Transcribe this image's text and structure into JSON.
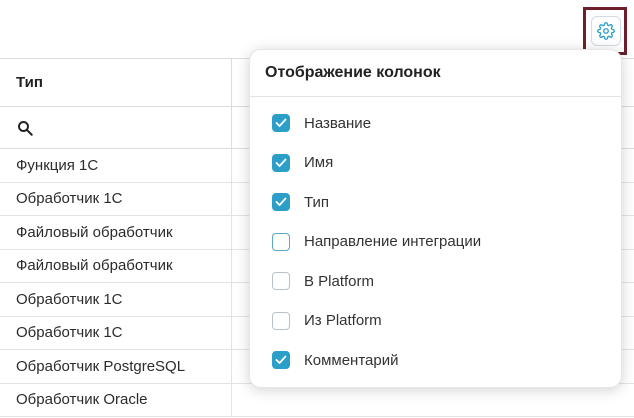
{
  "toolbar": {
    "settings_icon": "gear-icon",
    "accent": "#2b9fc8",
    "focus_border": "#6e1f2b"
  },
  "table": {
    "header": {
      "col1": "Тип",
      "col2": ""
    },
    "filter": {
      "icon": "search-icon"
    },
    "rows": [
      "Функция 1С",
      "Обработчик 1С",
      "Файловый обработчик",
      "Файловый обработчик",
      "Обработчик 1С",
      "Обработчик 1С",
      "Обработчик PostgreSQL",
      "Обработчик Oracle"
    ]
  },
  "column_popup": {
    "title": "Отображение колонок",
    "options": [
      {
        "label": "Название",
        "checked": true
      },
      {
        "label": "Имя",
        "checked": true
      },
      {
        "label": "Тип",
        "checked": true
      },
      {
        "label": "Направление интеграции",
        "checked": false
      },
      {
        "label": "В Platform",
        "checked": false
      },
      {
        "label": "Из Platform",
        "checked": false
      },
      {
        "label": "Комментарий",
        "checked": true
      }
    ]
  }
}
